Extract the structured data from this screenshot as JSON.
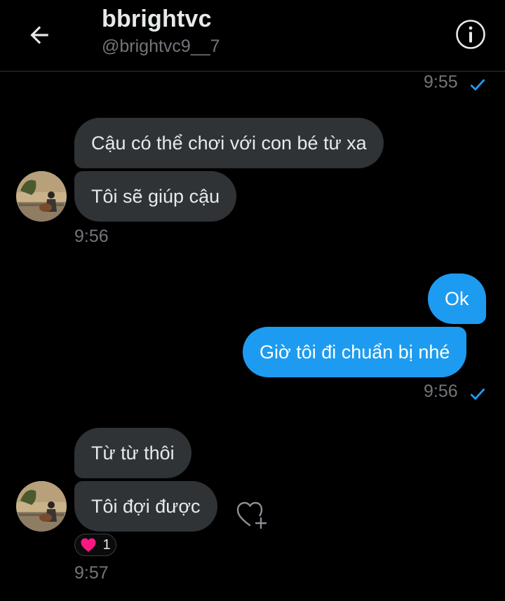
{
  "header": {
    "name": "bbrightvc",
    "handle": "@brightvc9__7",
    "back_icon": "back-arrow-icon",
    "info_icon": "info-icon"
  },
  "colors": {
    "background": "#000000",
    "incoming_bubble": "#2f3336",
    "outgoing_bubble": "#1d9bf0",
    "muted_text": "#71767b",
    "check": "#1d9bf0",
    "heart": "#f91880"
  },
  "messages": {
    "top_timestamp": "9:55",
    "incoming_1": "Cậu có thể chơi với con bé từ xa",
    "incoming_2": "Tôi sẽ giúp cậu",
    "incoming_time_1": "9:56",
    "outgoing_1": "Ok",
    "outgoing_2": "Giờ tôi đi chuẩn bị nhé",
    "outgoing_time": "9:56",
    "incoming_3": "Từ từ thôi",
    "incoming_4": "Tôi đợi được",
    "incoming_time_2": "9:57"
  },
  "reaction": {
    "icon": "heart-icon",
    "count": "1"
  }
}
